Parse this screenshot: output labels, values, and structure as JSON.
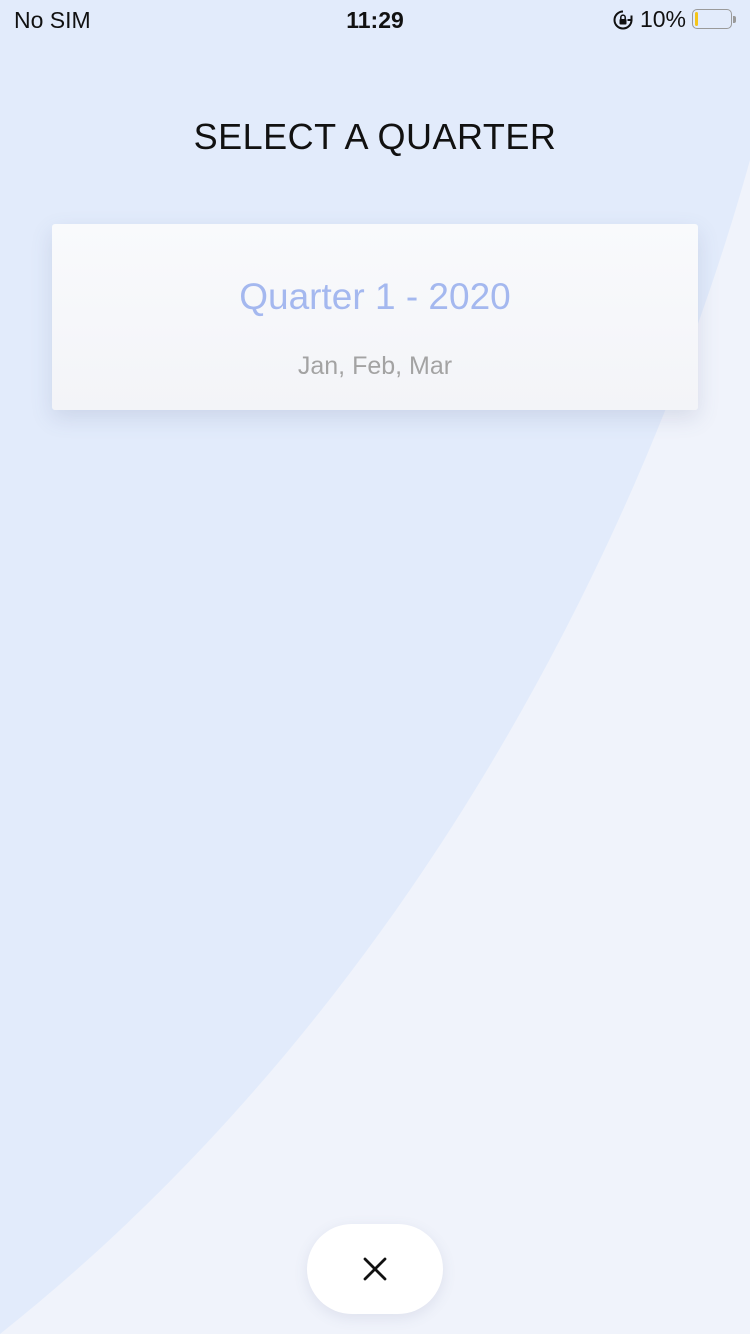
{
  "status_bar": {
    "carrier": "No SIM",
    "time": "11:29",
    "battery_percent": "10%",
    "battery_level": 0.1,
    "icons": [
      "rotation-lock-icon",
      "battery-icon"
    ]
  },
  "page": {
    "title": "SELECT A QUARTER"
  },
  "quarters": [
    {
      "label": "Quarter 1 - 2020",
      "months": "Jan, Feb, Mar"
    }
  ],
  "actions": {
    "close_icon": "close-icon"
  },
  "colors": {
    "background_primary": "#e2ebfb",
    "background_secondary": "#f0f3fb",
    "quarter_title": "#a4b8ef",
    "quarter_months": "#a3a3a3",
    "battery_fill": "#f5c518"
  }
}
